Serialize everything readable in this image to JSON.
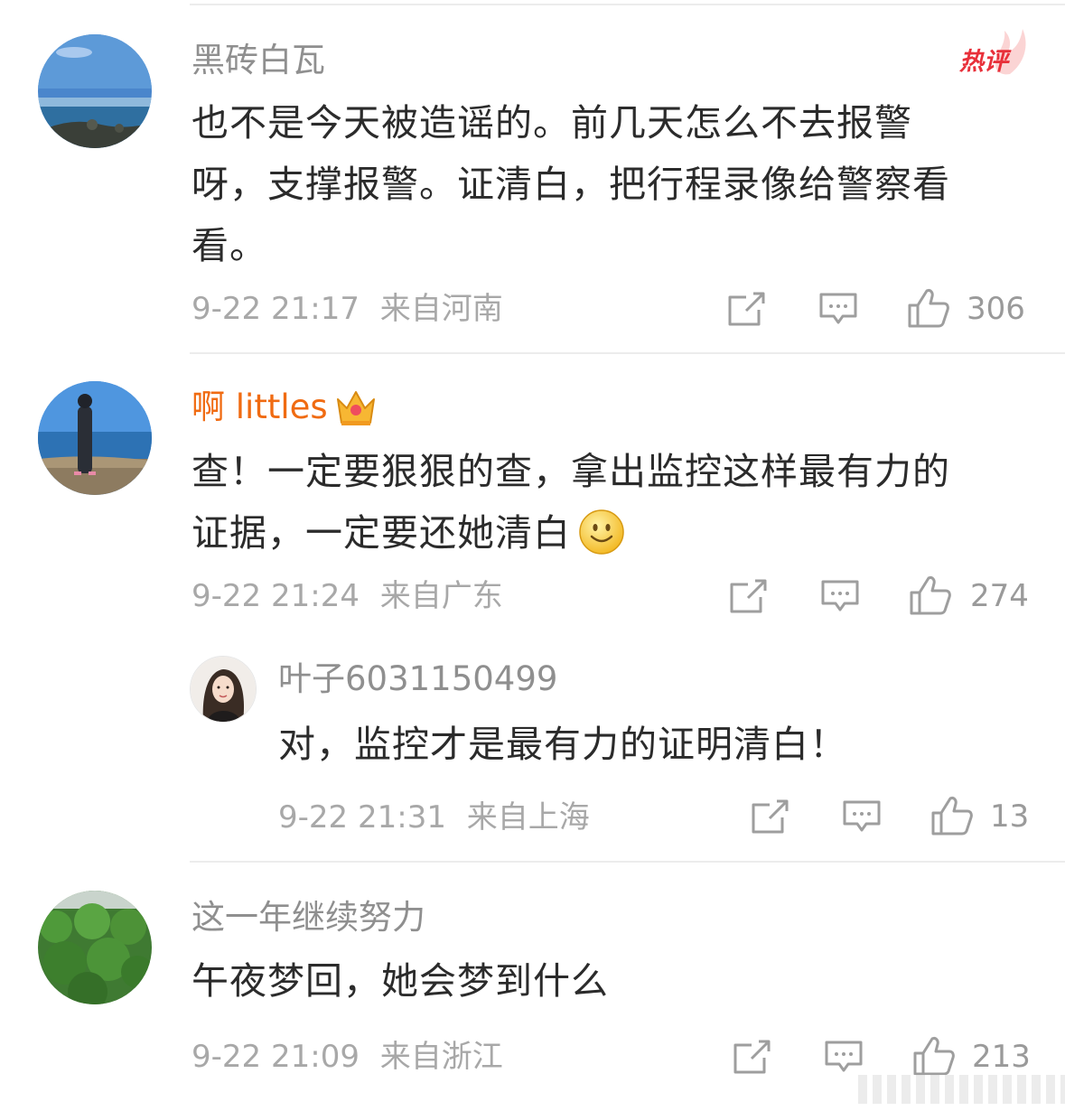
{
  "comments": [
    {
      "username": "黑砖白瓦",
      "badge": "热评",
      "text": "也不是今天被造谣的。前几天怎么不去报警呀，支撑报警。证清白，把行程录像给警察看看。",
      "text_lines": [
        "也不是今天被造谣的。前几天怎么不去报警",
        "呀，支撑报警。证清白，把行程录像给警察看",
        "看。"
      ],
      "time": "9-22 21:17",
      "location": "来自河南",
      "likes": "306"
    },
    {
      "username": "啊 littles",
      "username_color": "#f06b12",
      "text_lines": [
        "查！一定要狠狠的查，拿出监控这样最有力的",
        "证据，一定要还她清白"
      ],
      "time": "9-22 21:24",
      "location": "来自广东",
      "likes": "274",
      "reply": {
        "username": "叶子6031150499",
        "text": "对，监控才是最有力的证明清白！",
        "time": "9-22 21:31",
        "location": "来自上海",
        "likes": "13"
      }
    },
    {
      "username": "这一年继续努力",
      "text": "午夜梦回，她会梦到什么",
      "time": "9-22 21:09",
      "location": "来自浙江",
      "likes": "213"
    }
  ],
  "icons": {
    "repost": "share-square-icon",
    "comment": "comment-bubble-icon",
    "like": "thumbs-up-icon",
    "vip": "crown-icon",
    "emoji": "smiley-emoji-icon"
  }
}
